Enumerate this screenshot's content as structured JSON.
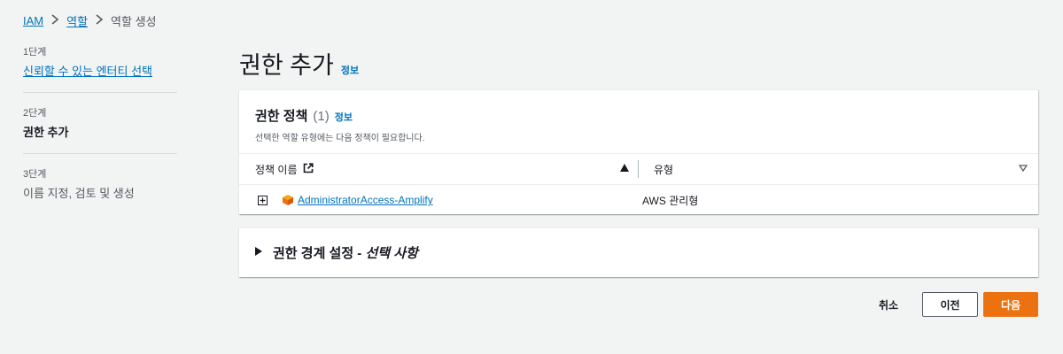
{
  "breadcrumb": {
    "items": [
      "IAM",
      "역할",
      "역할 생성"
    ]
  },
  "steps": [
    {
      "num": "1단계",
      "title": "신뢰할 수 있는 엔터티 선택",
      "state": "done"
    },
    {
      "num": "2단계",
      "title": "권한 추가",
      "state": "active"
    },
    {
      "num": "3단계",
      "title": "이름 지정, 검토 및 생성",
      "state": "pending"
    }
  ],
  "header": {
    "title": "권한 추가",
    "info": "정보"
  },
  "policies": {
    "title": "권한 정책",
    "count": "(1)",
    "info": "정보",
    "description": "선택한 역할 유형에는 다음 정책이 필요합니다.",
    "columns": {
      "name": "정책 이름",
      "type": "유형"
    },
    "rows": [
      {
        "name": "AdministratorAccess-Amplify",
        "type": "AWS 관리형"
      }
    ]
  },
  "boundary": {
    "title": "권한 경계 설정 - ",
    "optional": "선택 사항"
  },
  "actions": {
    "cancel": "취소",
    "previous": "이전",
    "next": "다음"
  },
  "colors": {
    "primary": "#ec7211",
    "link": "#0073bb",
    "background": "#f2f3f3"
  }
}
